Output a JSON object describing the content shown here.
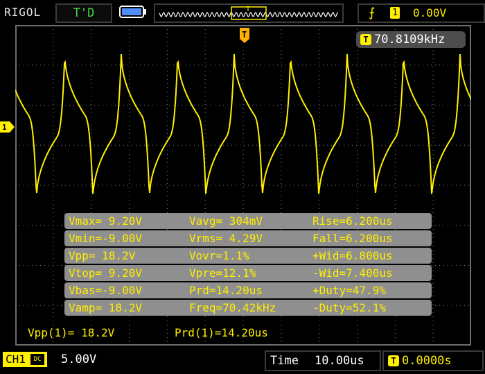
{
  "header": {
    "brand": "RIGOL",
    "trigger_status": "T'D",
    "trigger_edge_icon": "rising-edge-icon",
    "trigger_source": "1",
    "trigger_level": "0.00V"
  },
  "frequency_counter": {
    "icon": "T",
    "value": "70.8109kHz"
  },
  "channel_marker": "1",
  "measurements": [
    {
      "c1": "Vmax= 9.20V",
      "c2": "Vavg= 304mV",
      "c3": "Rise=6.200us"
    },
    {
      "c1": "Vmin=-9.00V",
      "c2": "Vrms= 4.29V",
      "c3": "Fall=6.200us"
    },
    {
      "c1": "Vpp= 18.2V",
      "c2": "Vovr=1.1%",
      "c3": "+Wid=6.800us"
    },
    {
      "c1": "Vtop= 9.20V",
      "c2": "Vpre=12.1%",
      "c3": "-Wid=7.400us"
    },
    {
      "c1": "Vbas=-9.00V",
      "c2": "Prd=14.20us",
      "c3": "+Duty=47.9%"
    },
    {
      "c1": "Vamp= 18.2V",
      "c2": "Freq=70.42kHz",
      "c3": "-Duty=52.1%"
    }
  ],
  "summary": {
    "left": "Vpp(1)= 18.2V",
    "right": "Prd(1)=14.20us"
  },
  "footer": {
    "channel_label": "CH1",
    "coupling": "DC",
    "volts_per_div": "5.00V",
    "time_label": "Time",
    "time_per_div": "10.00us",
    "trigger_offset_icon": "T",
    "trigger_offset": "0.0000s"
  },
  "colors": {
    "trace": "#ffef00",
    "grid": "#8a8a8a",
    "panel": "#8f8f8f",
    "status_green": "#46d93a"
  }
}
